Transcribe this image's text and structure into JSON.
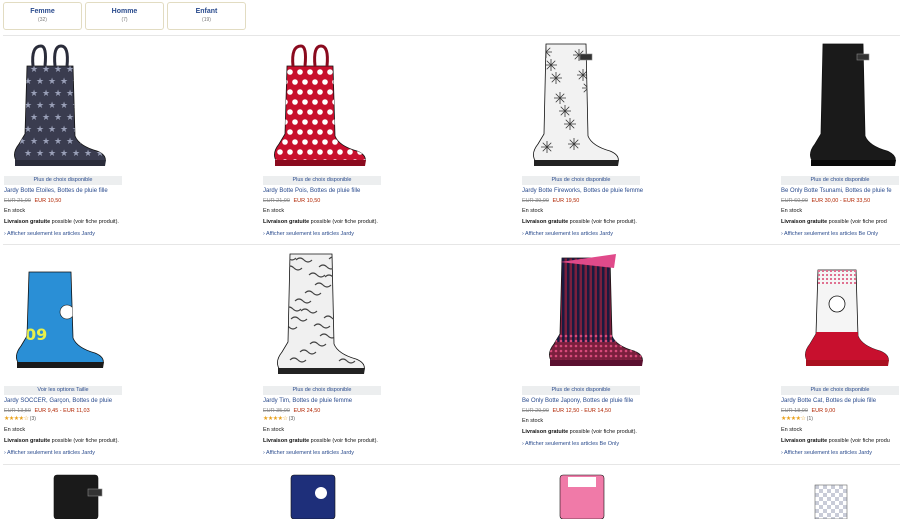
{
  "filters": [
    {
      "label": "Femme",
      "count": "(32)"
    },
    {
      "label": "Homme",
      "count": "(7)"
    },
    {
      "label": "Enfant",
      "count": "(19)"
    }
  ],
  "products": [
    {
      "option": "Plus de choix disponible",
      "title": "Jardy Botte Etoiles, Bottes de pluie fille",
      "old_price": "EUR 21,00",
      "price": "EUR 10,50",
      "rating": "",
      "stock": "En stock",
      "shipping_bold": "Livraison gratuite",
      "shipping_rest": " possible (voir fiche produit).",
      "more": "› Afficher seulement les articles Jardy"
    },
    {
      "option": "Plus de choix disponible",
      "title": "Jardy Botte Pois, Bottes de pluie fille",
      "old_price": "EUR 21,00",
      "price": "EUR 10,50",
      "rating": "",
      "stock": "En stock",
      "shipping_bold": "Livraison gratuite",
      "shipping_rest": " possible (voir fiche produit).",
      "more": "› Afficher seulement les articles Jardy"
    },
    {
      "option": "Plus de choix disponible",
      "title": "Jardy Botte Fireworks, Bottes de pluie femme",
      "old_price": "EUR 39,00",
      "price": "EUR 19,50",
      "rating": "",
      "stock": "En stock",
      "shipping_bold": "Livraison gratuite",
      "shipping_rest": " possible (voir fiche produit).",
      "more": "› Afficher seulement les articles Jardy"
    },
    {
      "option": "Plus de choix disponible",
      "title": "Be Only Botte Tsunami, Bottes de pluie fe",
      "old_price": "EUR 60,00",
      "price": "EUR 30,00 - EUR 33,50",
      "rating": "",
      "stock": "En stock",
      "shipping_bold": "Livraison gratuite",
      "shipping_rest": " possible (voir fiche prod",
      "more": "› Afficher seulement les articles Be Only"
    },
    {
      "option": "Voir les options Taille",
      "title": "Jardy SOCCER, Garçon, Bottes de pluie",
      "old_price": "EUR 13,50",
      "price": "EUR 9,45 - EUR 11,03",
      "rating": "(3)",
      "stock": "En stock",
      "shipping_bold": "Livraison gratuite",
      "shipping_rest": " possible (voir fiche produit).",
      "more": "› Afficher seulement les articles Jardy"
    },
    {
      "option": "Plus de choix disponible",
      "title": "Jardy Tim, Bottes de pluie femme",
      "old_price": "EUR 35,00",
      "price": "EUR 24,50",
      "rating": "(3)",
      "stock": "En stock",
      "shipping_bold": "Livraison gratuite",
      "shipping_rest": " possible (voir fiche produit).",
      "more": "› Afficher seulement les articles Jardy"
    },
    {
      "option": "Plus de choix disponible",
      "title": "Be Only Botte Japony, Bottes de pluie fille",
      "old_price": "EUR 29,00",
      "price": "EUR 12,50 - EUR 14,50",
      "rating": "",
      "stock": "En stock",
      "shipping_bold": "Livraison gratuite",
      "shipping_rest": " possible (voir fiche produit).",
      "more": "› Afficher seulement les articles Be Only"
    },
    {
      "option": "Plus de choix disponible",
      "title": "Jardy Botte Cat, Bottes de pluie fille",
      "old_price": "EUR 18,00",
      "price": "EUR 9,00",
      "rating": "(1)",
      "stock": "En stock",
      "shipping_bold": "Livraison gratuite",
      "shipping_rest": " possible (voir fiche produ",
      "more": "› Afficher seulement les articles Jardy"
    }
  ],
  "boot_images": [
    {
      "name": "boot-etoiles-image",
      "body": "#3a3c4f",
      "accent": "#9aa0b8",
      "pattern": "stars",
      "handle": true,
      "sole": "#2a2c3a"
    },
    {
      "name": "boot-pois-image",
      "body": "#c8102e",
      "accent": "#ffffff",
      "pattern": "dots",
      "handle": true,
      "sole": "#8a0a1e"
    },
    {
      "name": "boot-fireworks-image",
      "body": "#f2f2f2",
      "accent": "#333333",
      "pattern": "fireworks",
      "handle": false,
      "sole": "#222222"
    },
    {
      "name": "boot-tsunami-image",
      "body": "#1a1a1a",
      "accent": "#555555",
      "pattern": "plain",
      "handle": false,
      "sole": "#0a0a0a"
    },
    {
      "name": "boot-soccer-image",
      "body": "#2a8fd6",
      "accent": "#e8f04a",
      "pattern": "soccer",
      "handle": false,
      "sole": "#1a1a1a"
    },
    {
      "name": "boot-tim-image",
      "body": "#f0f0f0",
      "accent": "#444444",
      "pattern": "graffiti",
      "handle": false,
      "sole": "#222222"
    },
    {
      "name": "boot-japony-image",
      "body": "#7a1f3d",
      "accent": "#1a1a40",
      "pattern": "stripes",
      "handle": false,
      "sole": "#5a1030"
    },
    {
      "name": "boot-cat-image",
      "body": "#f5f5f5",
      "accent": "#c8102e",
      "pattern": "cat",
      "handle": false,
      "sole": "#aa1020"
    }
  ],
  "bottom_row": [
    {
      "name": "boot-black-partial-image",
      "body": "#1a1a1a"
    },
    {
      "name": "boot-navy-partial-image",
      "body": "#1e2f7a"
    },
    {
      "name": "boot-pink-partial-image",
      "body": "#f07aa8"
    },
    {
      "name": "boot-gingham-partial-image",
      "body": "#9aa0b8"
    }
  ]
}
